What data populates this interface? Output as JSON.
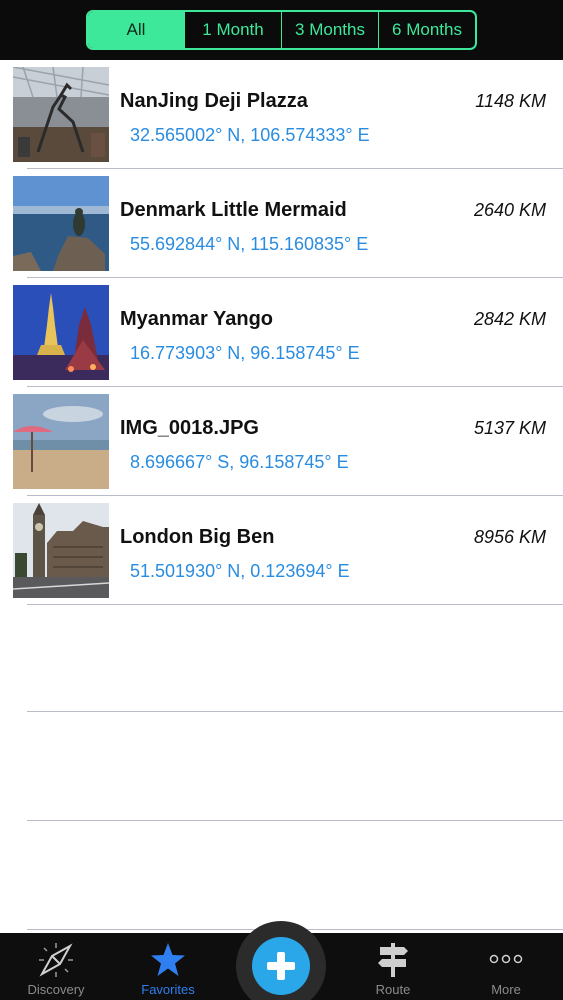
{
  "filters": {
    "all": "All",
    "one_month": "1 Month",
    "three_months": "3 Months",
    "six_months": "6 Months"
  },
  "places": [
    {
      "name": "NanJing Deji Plazza",
      "distance": "1148 KM",
      "coords": "32.565002° N, 106.574333° E",
      "thumb": "mall-photo"
    },
    {
      "name": "Denmark Little Mermaid",
      "distance": "2640 KM",
      "coords": "55.692844° N, 115.160835° E",
      "thumb": "mermaid-photo"
    },
    {
      "name": "Myanmar Yango",
      "distance": "2842 KM",
      "coords": "16.773903° N, 96.158745° E",
      "thumb": "pagoda-photo"
    },
    {
      "name": "IMG_0018.JPG",
      "distance": "5137 KM",
      "coords": "8.696667° S, 96.158745° E",
      "thumb": "beach-photo"
    },
    {
      "name": "London Big Ben",
      "distance": "8956 KM",
      "coords": "51.501930° N, 0.123694° E",
      "thumb": "bigben-photo"
    }
  ],
  "tabbar": {
    "discovery": "Discovery",
    "favorites": "Favorites",
    "route": "Route",
    "more": "More"
  },
  "colors": {
    "accent_green": "#3ee89a",
    "link_blue": "#2a8ce0",
    "tab_active": "#2f7ff0",
    "add_button": "#2aa7e8"
  },
  "icons": {
    "discovery": "compass-icon",
    "favorites": "star-icon",
    "add": "plus-icon",
    "route": "signpost-icon",
    "more": "more-dots-icon"
  }
}
